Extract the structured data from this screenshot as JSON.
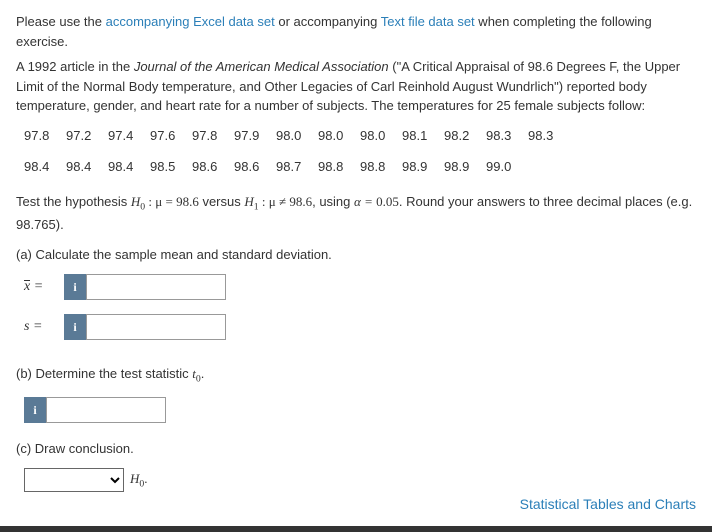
{
  "intro": {
    "t1": "Please use the ",
    "link1": "accompanying Excel data set",
    "t2": " or accompanying ",
    "link2": "Text file data set",
    "t3": " when completing the following exercise."
  },
  "article": {
    "t1": "A 1992 article in the ",
    "journal": "Journal of the American Medical Association",
    "t2": " (\"A Critical Appraisal of 98.6 Degrees F, the Upper Limit of the Normal Body temperature, and Other Legacies of Carl Reinhold August Wundrlich\") reported body temperature, gender, and heart rate for a number of subjects. The temperatures for 25 female subjects follow:"
  },
  "chart_data": {
    "type": "table",
    "rows": [
      [
        "97.8",
        "97.2",
        "97.4",
        "97.6",
        "97.8",
        "97.9",
        "98.0",
        "98.0",
        "98.0",
        "98.1",
        "98.2",
        "98.3",
        "98.3"
      ],
      [
        "98.4",
        "98.4",
        "98.4",
        "98.5",
        "98.6",
        "98.6",
        "98.7",
        "98.8",
        "98.8",
        "98.9",
        "98.9",
        "99.0",
        ""
      ]
    ]
  },
  "hypothesis": {
    "pre": "Test the hypothesis ",
    "h0": "H",
    "h0sub": "0",
    "colon1_mu_eq": " : μ = ",
    "val0": "98.6",
    "versus": " versus ",
    "h1": "H",
    "h1sub": "1",
    "colon2_mu_ne": " : μ ≠ ",
    "val1": "98.6",
    "using": ", using ",
    "alpha": "α = ",
    "aval": "0.05",
    "tail": ". Round your answers to three decimal places (e.g. 98.765)."
  },
  "parts": {
    "a": "(a) Calculate the sample mean and standard deviation.",
    "b": "(b) Determine the test statistic ",
    "b_sym": "t",
    "b_sub": "0",
    "b_dot": ".",
    "c": "(c) Draw conclusion."
  },
  "labels": {
    "xbar": "x",
    "xbar_eq": " =",
    "s": "s",
    "s_eq": " =",
    "info": "i",
    "h0_text": "H",
    "h0_text_sub": "0",
    "h0_dot": "."
  },
  "inputs": {
    "xbar_value": "",
    "s_value": "",
    "t0_value": "",
    "conclusion_value": ""
  },
  "footer": {
    "link": "Statistical Tables and Charts"
  }
}
